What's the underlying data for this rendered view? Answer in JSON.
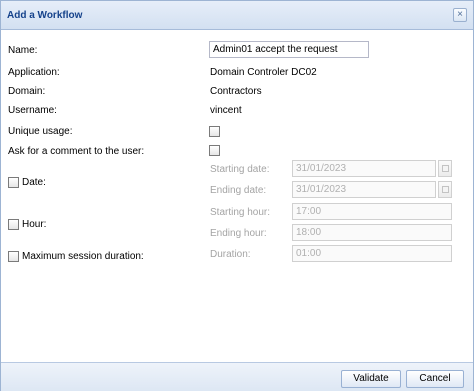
{
  "window": {
    "title": "Add a Workflow",
    "close_glyph": "×"
  },
  "form": {
    "name": {
      "label": "Name:",
      "value": "Admin01 accept the request"
    },
    "application": {
      "label": "Application:",
      "value": "Domain Controler DC02"
    },
    "domain": {
      "label": "Domain:",
      "value": "Contractors"
    },
    "username": {
      "label": "Username:",
      "value": "vincent"
    },
    "unique_usage": {
      "label": "Unique usage:",
      "checked": false
    },
    "ask_comment": {
      "label": "Ask for a comment to the user:",
      "checked": false
    },
    "date": {
      "label": "Date:",
      "checked": false,
      "starting_label": "Starting date:",
      "starting_value": "31/01/2023",
      "ending_label": "Ending date:",
      "ending_value": "31/01/2023"
    },
    "hour": {
      "label": "Hour:",
      "checked": false,
      "starting_label": "Starting hour:",
      "starting_value": "17:00",
      "ending_label": "Ending hour:",
      "ending_value": "18:00"
    },
    "session": {
      "label": "Maximum session duration:",
      "checked": false,
      "duration_label": "Duration:",
      "duration_value": "01:00"
    }
  },
  "footer": {
    "validate_label": "Validate",
    "cancel_label": "Cancel"
  },
  "icons": {
    "close": "close-icon",
    "calendar": "calendar-icon"
  },
  "colors": {
    "title_text": "#15428b",
    "disabled_text": "#a4a4a4",
    "border_accent": "#99b1d3"
  }
}
